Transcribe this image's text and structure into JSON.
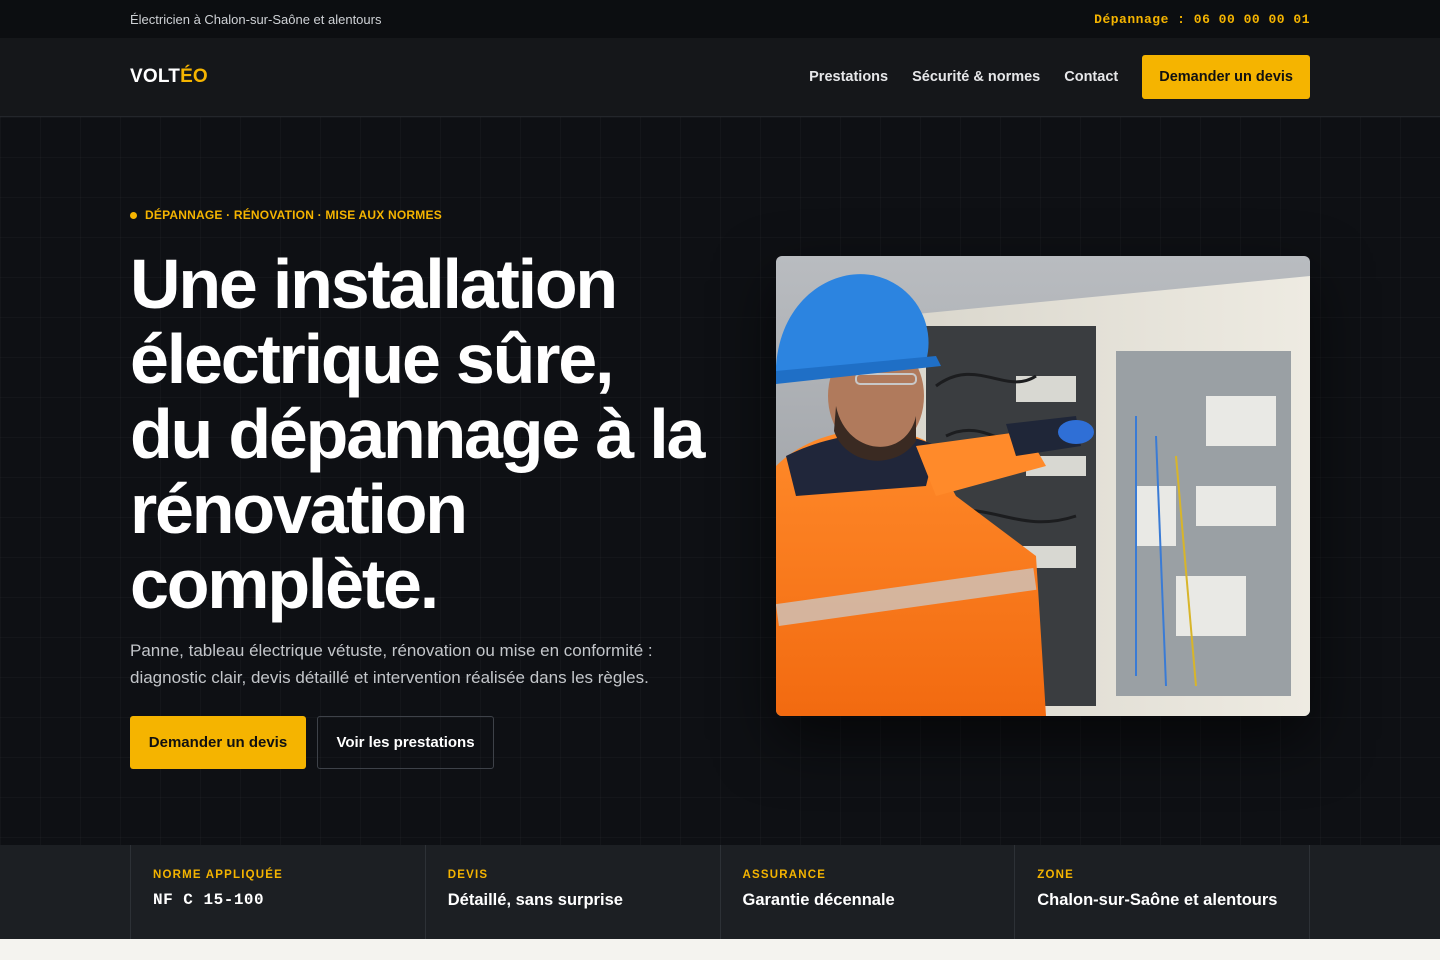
{
  "topbar": {
    "tagline": "Électricien à Chalon-sur-Saône et alentours",
    "phone": "Dépannage : 06 00 00 00 01"
  },
  "nav": {
    "logo_a": "VOLT",
    "logo_b": "ÉO",
    "links": [
      "Prestations",
      "Sécurité & normes",
      "Contact"
    ],
    "cta": "Demander un devis"
  },
  "hero": {
    "eyebrow": "DÉPANNAGE · RÉNOVATION · MISE AUX NORMES",
    "title": "Une installation électrique sûre, du dépannage à la rénovation complète.",
    "text": "Panne, tableau électrique vétuste, rénovation ou mise en conformité : diagnostic clair, devis détaillé et intervention réalisée dans les règles.",
    "btn_primary": "Demander un devis",
    "btn_secondary": "Voir les prestations"
  },
  "stats": [
    {
      "label": "NORME APPLIQUÉE",
      "value": "NF C 15-100"
    },
    {
      "label": "DEVIS",
      "value": "Détaillé, sans surprise"
    },
    {
      "label": "ASSURANCE",
      "value": "Garantie décennale"
    },
    {
      "label": "ZONE",
      "value": "Chalon-sur-Saône et alentours"
    }
  ],
  "colors": {
    "accent": "#f5b400",
    "background": "#0e1014",
    "band": "#1c1f23"
  }
}
